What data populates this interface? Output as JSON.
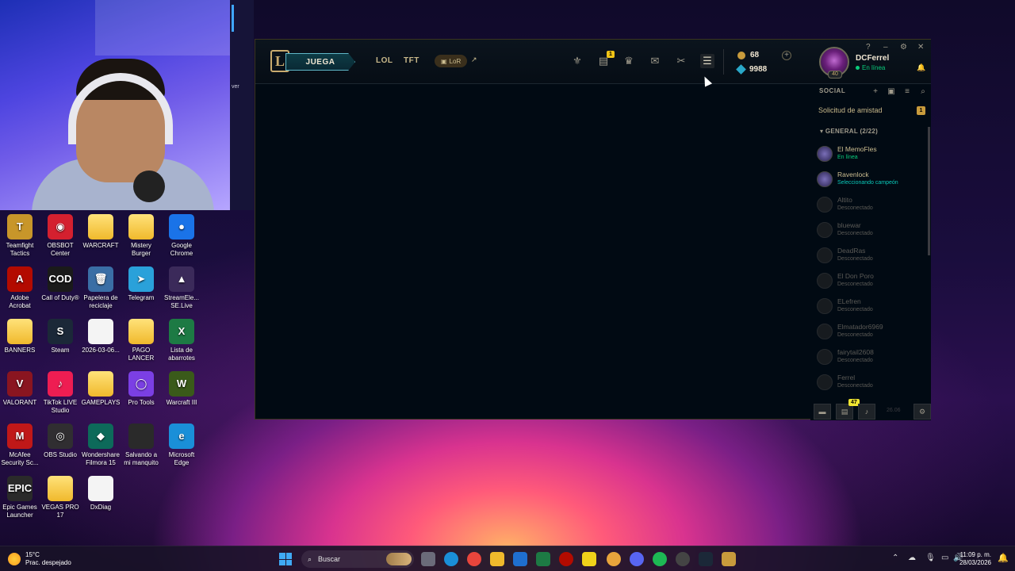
{
  "webcam": {
    "side_text": "ver"
  },
  "desktop_icons": [
    {
      "label": "Teamfight Tactics",
      "glyph": "T",
      "color": "#c8962a"
    },
    {
      "label": "OBSBOT Center",
      "glyph": "◉",
      "color": "#d4202f"
    },
    {
      "label": "WARCRAFT",
      "glyph": "",
      "color": "folder"
    },
    {
      "label": "Mistery Burger",
      "glyph": "",
      "color": "folder"
    },
    {
      "label": "Google Chrome",
      "glyph": "●",
      "color": "#1a73e8"
    },
    {
      "label": "Adobe Acrobat",
      "glyph": "A",
      "color": "#b30b00"
    },
    {
      "label": "Call of Duty®",
      "glyph": "COD",
      "color": "#1a1a1a"
    },
    {
      "label": "Papelera de reciclaje",
      "glyph": "🗑",
      "color": "#3a6ea5"
    },
    {
      "label": "Telegram",
      "glyph": "➤",
      "color": "#2aa1da"
    },
    {
      "label": "StreamEle... SE.Live",
      "glyph": "▲",
      "color": "#3b2a5a"
    },
    {
      "label": "BANNERS",
      "glyph": "",
      "color": "folder"
    },
    {
      "label": "Steam",
      "glyph": "S",
      "color": "#1b2838"
    },
    {
      "label": "2026-03-06...",
      "glyph": "",
      "color": "#f4f4f4"
    },
    {
      "label": "PAGO LANCER",
      "glyph": "",
      "color": "folder"
    },
    {
      "label": "Lista de abarrotes",
      "glyph": "X",
      "color": "#1d7a44"
    },
    {
      "label": "VALORANT",
      "glyph": "V",
      "color": "#8a1520"
    },
    {
      "label": "TikTok LIVE Studio",
      "glyph": "♪",
      "color": "#ee1d52"
    },
    {
      "label": "GAMEPLAYS",
      "glyph": "",
      "color": "folder"
    },
    {
      "label": "Pro Tools",
      "glyph": "◯",
      "color": "#7b3fe4"
    },
    {
      "label": "Warcraft III",
      "glyph": "W",
      "color": "#3a5a1a"
    },
    {
      "label": "McAfee Security Sc...",
      "glyph": "M",
      "color": "#c01818"
    },
    {
      "label": "OBS Studio",
      "glyph": "◎",
      "color": "#302e31"
    },
    {
      "label": "Wondershare Filmora 15",
      "glyph": "◆",
      "color": "#0d6a5a"
    },
    {
      "label": "Salvando a mi manquito",
      "glyph": "",
      "color": "#2a2a2a"
    },
    {
      "label": "Microsoft Edge",
      "glyph": "e",
      "color": "#1a8fd8"
    },
    {
      "label": "Epic Games Launcher",
      "glyph": "EPIC",
      "color": "#2a2a2a"
    },
    {
      "label": "VEGAS PRO 17",
      "glyph": "",
      "color": "folder"
    },
    {
      "label": "DxDiag",
      "glyph": "",
      "color": "#f4f4f4"
    }
  ],
  "client": {
    "play_label": "JUEGA",
    "nav": [
      "LOL",
      "TFT"
    ],
    "lor_label": "LoR",
    "store_badge": "1",
    "rp": "68",
    "blue_essence": "9988",
    "summoner_name": "DCFerrel",
    "status": "En línea",
    "level": "40",
    "window_controls": [
      "?",
      "–",
      "⚙",
      "✕"
    ],
    "social": {
      "header": "SOCIAL",
      "friend_request": "Solicitud de amistad",
      "friend_request_count": "1",
      "group": "GENERAL (2/22)",
      "friends": [
        {
          "name": "El MemoFles",
          "status": "En línea",
          "state": "online"
        },
        {
          "name": "Ravenlock",
          "status": "Seleccionando campeón",
          "state": "ingame"
        },
        {
          "name": "Altito",
          "status": "Desconectado",
          "state": "offline"
        },
        {
          "name": "bluewar",
          "status": "Desconectado",
          "state": "offline"
        },
        {
          "name": "DeadRas",
          "status": "Desconectado",
          "state": "offline"
        },
        {
          "name": "El Don Poro",
          "status": "Desconectado",
          "state": "offline"
        },
        {
          "name": "ELefren",
          "status": "Desconectado",
          "state": "offline"
        },
        {
          "name": "Elmatador6969",
          "status": "Desconectado",
          "state": "offline"
        },
        {
          "name": "fairytail2608",
          "status": "Desconectado",
          "state": "offline"
        },
        {
          "name": "Ferrel",
          "status": "Desconectado",
          "state": "offline"
        }
      ]
    },
    "bottom_badge": "47",
    "version": "26.06"
  },
  "taskbar": {
    "temperature": "15°C",
    "weather": "Prac. despejado",
    "search_placeholder": "Buscar",
    "time": "11:09 p. m.",
    "date": "28/03/2026"
  },
  "colors": {
    "online": "#0acb7b",
    "ingame": "#0ac8b9",
    "offline": "#5b5a56",
    "gold": "#c8aa6e"
  }
}
